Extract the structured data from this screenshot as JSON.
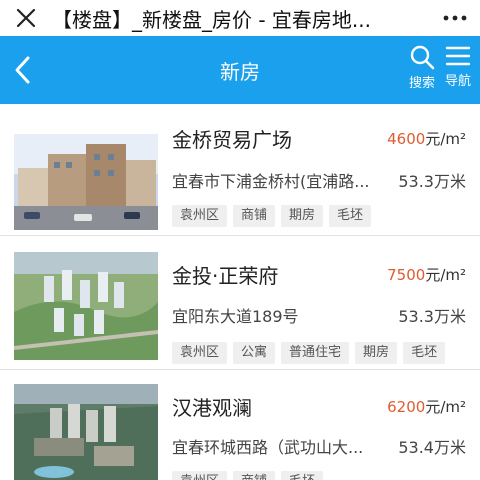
{
  "browser": {
    "title": "【楼盘】_新楼盘_房价 - 宜春房地..."
  },
  "header": {
    "title": "新房",
    "search_label": "搜索",
    "nav_label": "导航"
  },
  "colors": {
    "header_bg": "#1aa0ec",
    "price_accent": "#e05b30"
  },
  "listings": [
    {
      "name": "金桥贸易广场",
      "price": "4600",
      "price_unit": "元/m²",
      "address": "宜春市下浦金桥村(宜浦路...",
      "distance": "53.3万米",
      "tags": [
        "袁州区",
        "商铺",
        "期房",
        "毛坯"
      ]
    },
    {
      "name": "金投·正荣府",
      "price": "7500",
      "price_unit": "元/m²",
      "address": "宜阳东大道189号",
      "distance": "53.3万米",
      "tags": [
        "袁州区",
        "公寓",
        "普通住宅",
        "期房",
        "毛坯"
      ]
    },
    {
      "name": "汉港观澜",
      "price": "6200",
      "price_unit": "元/m²",
      "address": "宜春环城西路（武功山大...",
      "distance": "53.4万米",
      "tags": [
        "袁州区",
        "商铺",
        "毛坯"
      ]
    }
  ]
}
